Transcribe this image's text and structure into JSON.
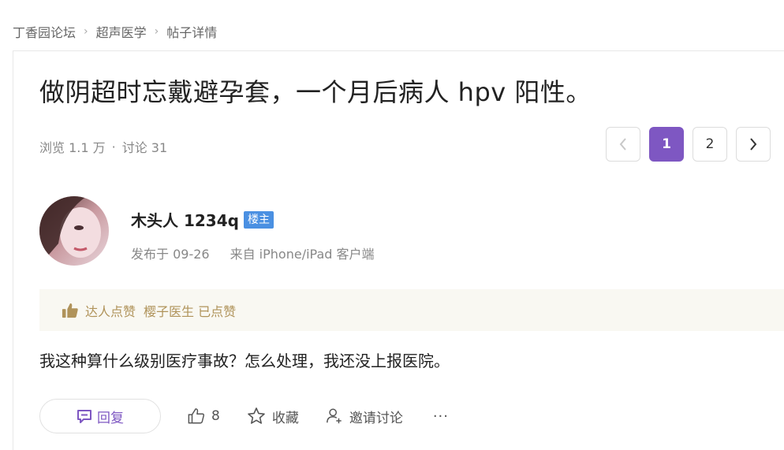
{
  "breadcrumb": [
    "丁香园论坛",
    "超声医学",
    "帖子详情"
  ],
  "post": {
    "title": "做阴超时忘戴避孕套，一个月后病人 hpv 阳性。",
    "views": "浏览 1.1 万",
    "dot": "·",
    "discussions": "讨论 31",
    "content": "我这种算什么级别医疗事故？怎么处理，我还没上报医院。"
  },
  "pagination": {
    "prev": "‹",
    "pages": [
      "1",
      "2"
    ],
    "current": "1",
    "next": "›"
  },
  "author": {
    "name": "木头人 1234q",
    "badge": "楼主",
    "posted": "发布于 09-26",
    "client": "来自 iPhone/iPad 客户端"
  },
  "likes": {
    "label": "达人点赞",
    "liker": "樱子医生 已点赞"
  },
  "actions": {
    "reply": "回复",
    "like_count": "8",
    "favorite": "收藏",
    "invite": "邀请讨论",
    "more": "···"
  },
  "colors": {
    "accent": "#7e57c2",
    "badge": "#4a90e2",
    "likes_bg": "#f9f8f2",
    "likes_text": "#b0935a"
  }
}
